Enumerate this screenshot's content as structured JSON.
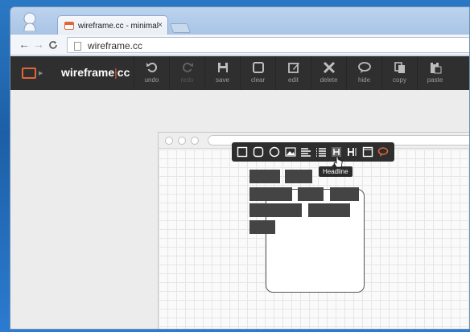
{
  "browser": {
    "tab_title": "wireframe.cc - minimal w",
    "tab_close": "×",
    "url": "wireframe.cc",
    "nav": {
      "back": "←",
      "forward": "→",
      "reload": "C"
    }
  },
  "app": {
    "logo": {
      "name": "wireframe",
      "separator": "|",
      "suffix": "cc"
    },
    "toolbar": [
      {
        "label": "undo",
        "icon": "undo-icon",
        "enabled": true
      },
      {
        "label": "redo",
        "icon": "redo-icon",
        "enabled": false
      },
      {
        "label": "save",
        "icon": "save-icon",
        "enabled": true
      },
      {
        "label": "clear",
        "icon": "clear-icon",
        "enabled": true
      },
      {
        "label": "edit",
        "icon": "edit-icon",
        "enabled": true
      },
      {
        "label": "delete",
        "icon": "delete-icon",
        "enabled": true
      },
      {
        "label": "hide",
        "icon": "hide-icon",
        "enabled": true
      },
      {
        "label": "copy",
        "icon": "copy-icon",
        "enabled": true
      },
      {
        "label": "paste",
        "icon": "paste-icon",
        "enabled": true
      }
    ]
  },
  "palette": {
    "items": [
      "rectangle-icon",
      "rounded-rectangle-icon",
      "circle-icon",
      "image-icon",
      "paragraph-icon",
      "list-icon",
      "headline-icon",
      "text-icon",
      "browser-icon",
      "comment-icon"
    ],
    "tooltip": "Headline"
  },
  "colors": {
    "accent": "#e0653a",
    "toolbar_bg": "#2f2f2f",
    "block": "#444444"
  }
}
